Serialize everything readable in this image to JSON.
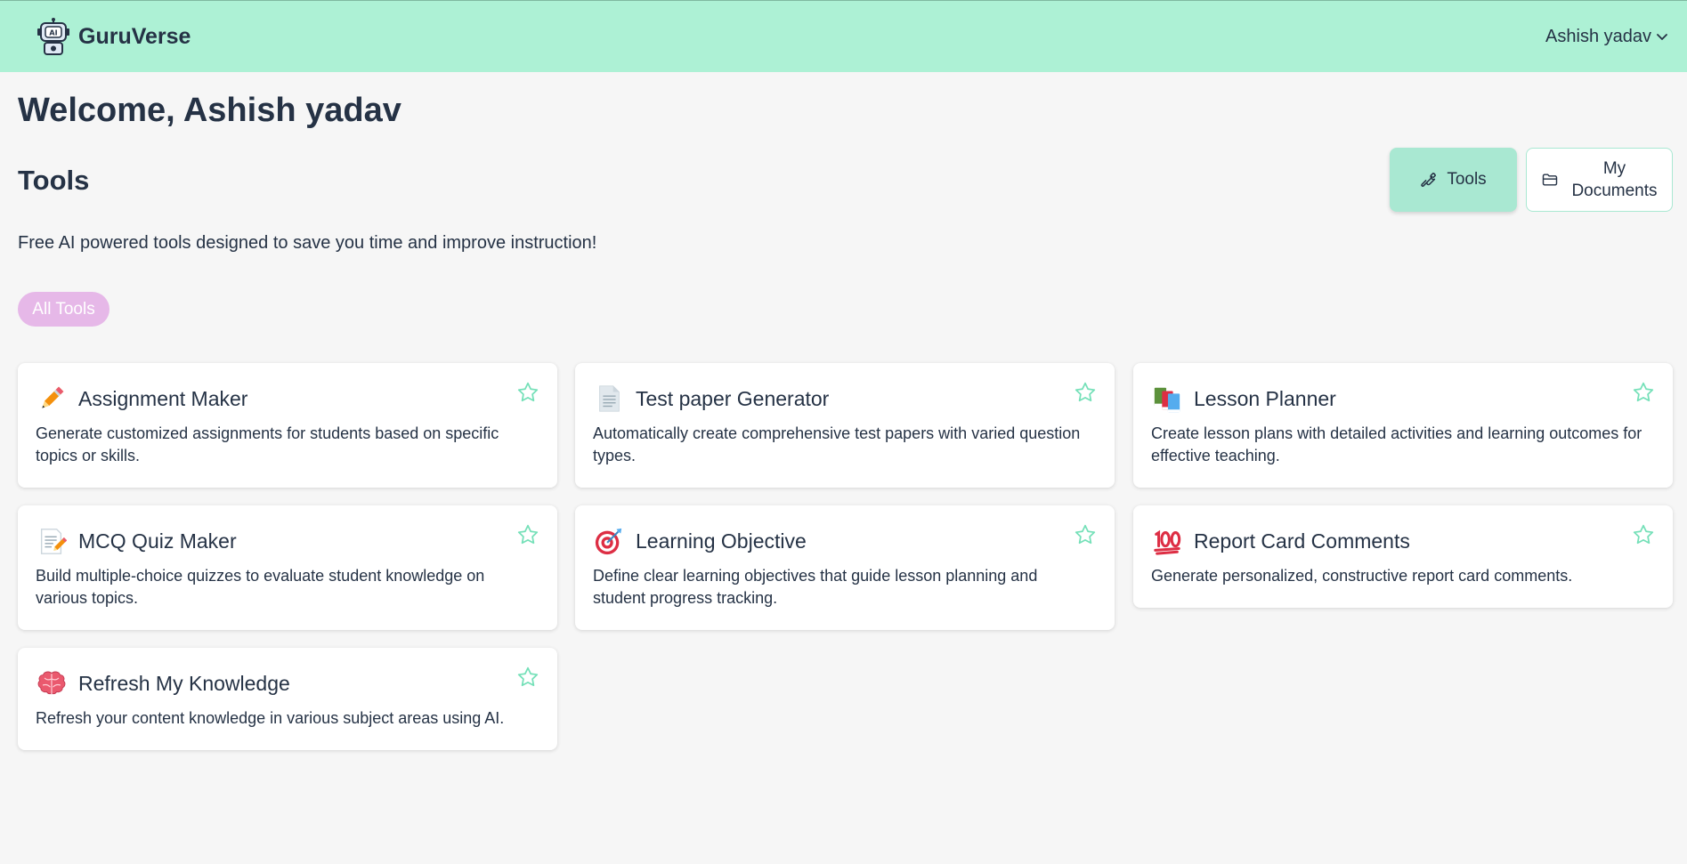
{
  "app": {
    "name": "GuruVerse",
    "logo_icon": "robot-ai-icon"
  },
  "user_menu": {
    "name": "Ashish yadav",
    "icon": "chevron-down-icon"
  },
  "welcome": "Welcome, Ashish yadav",
  "section_title": "Tools",
  "subtitle": "Free AI powered tools designed to save you time and improve instruction!",
  "view_switch": {
    "tools_label": "Tools",
    "tools_icon": "wrench-icon",
    "docs_label_line1": "My",
    "docs_label_line2": "Documents",
    "docs_icon": "folder-icon"
  },
  "filter": {
    "active": "All Tools"
  },
  "colors": {
    "header": "#adf1d5",
    "accent": "#a9e8d2",
    "pill": "#e6b8e8",
    "star": "#74e0b8",
    "text": "#253245"
  },
  "tools": [
    {
      "title": "Assignment Maker",
      "description": "Generate customized assignments for students based on specific topics or skills.",
      "icon": "pencil-icon"
    },
    {
      "title": "Test paper Generator",
      "description": "Automatically create comprehensive test papers with varied question types.",
      "icon": "document-icon"
    },
    {
      "title": "Lesson Planner",
      "description": "Create lesson plans with detailed activities and learning outcomes for effective teaching.",
      "icon": "books-icon"
    },
    {
      "title": "MCQ Quiz Maker",
      "description": "Build multiple-choice quizzes to evaluate student knowledge on various topics.",
      "icon": "memo-icon"
    },
    {
      "title": "Learning Objective",
      "description": "Define clear learning objectives that guide lesson planning and student progress tracking.",
      "icon": "target-icon"
    },
    {
      "title": "Report Card Comments",
      "description": "Generate personalized, constructive report card comments.",
      "icon": "hundred-points-icon"
    },
    {
      "title": "Refresh My Knowledge",
      "description": "Refresh your content knowledge in various subject areas using AI.",
      "icon": "brain-icon"
    }
  ]
}
